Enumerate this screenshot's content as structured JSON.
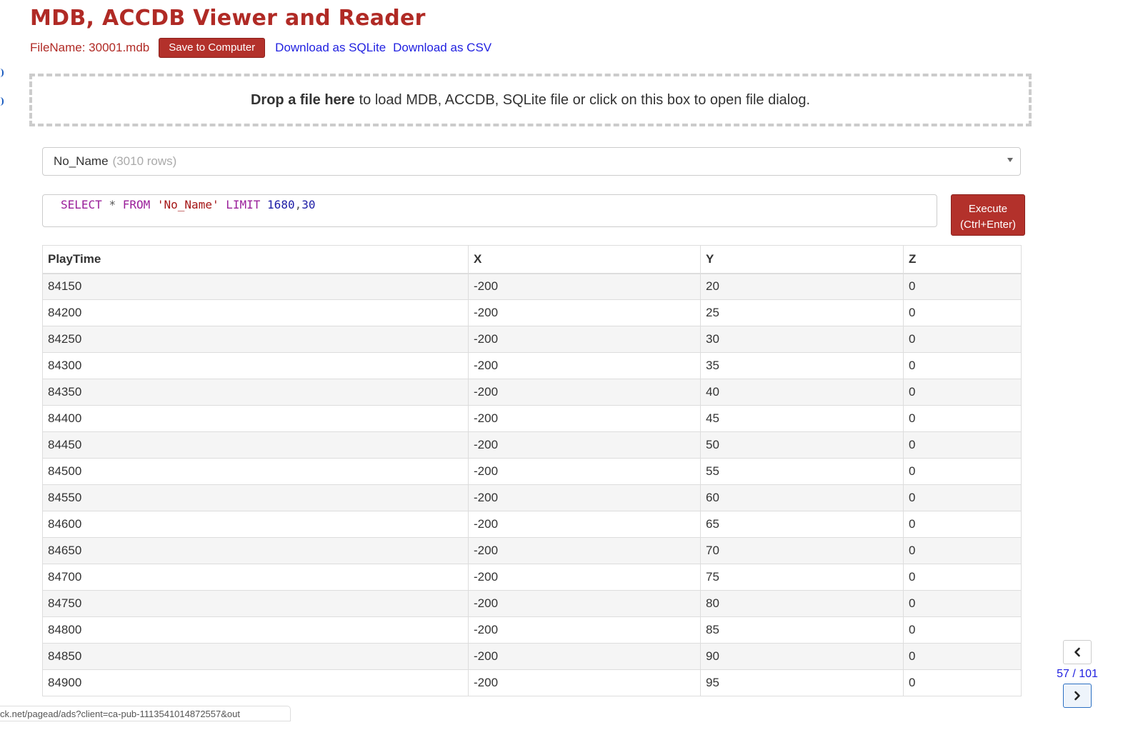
{
  "app": {
    "title": "MDB, ACCDB Viewer and Reader"
  },
  "file_bar": {
    "filename": "FileName: 30001.mdb",
    "save_label": "Save to Computer",
    "download_sqlite": "Download as SQLite",
    "download_csv": "Download as CSV"
  },
  "dropzone": {
    "bold_text": "Drop a file here",
    "rest_text": "to load MDB, ACCDB, SQLite file or click on this box to open file dialog."
  },
  "table_select": {
    "selected": "No_Name",
    "rows": "(3010 rows)"
  },
  "query": {
    "select_kw": "SELECT",
    "star": "*",
    "from_kw": "FROM",
    "table": "'No_Name'",
    "limit_kw": "LIMIT",
    "offset": "1680",
    "comma": ",",
    "count": "30"
  },
  "execute": {
    "line1": "Execute",
    "line2": "(Ctrl+Enter)"
  },
  "results": {
    "columns": [
      "PlayTime",
      "X",
      "Y",
      "Z"
    ],
    "rows": [
      [
        "84150",
        "-200",
        "20",
        "0"
      ],
      [
        "84200",
        "-200",
        "25",
        "0"
      ],
      [
        "84250",
        "-200",
        "30",
        "0"
      ],
      [
        "84300",
        "-200",
        "35",
        "0"
      ],
      [
        "84350",
        "-200",
        "40",
        "0"
      ],
      [
        "84400",
        "-200",
        "45",
        "0"
      ],
      [
        "84450",
        "-200",
        "50",
        "0"
      ],
      [
        "84500",
        "-200",
        "55",
        "0"
      ],
      [
        "84550",
        "-200",
        "60",
        "0"
      ],
      [
        "84600",
        "-200",
        "65",
        "0"
      ],
      [
        "84650",
        "-200",
        "70",
        "0"
      ],
      [
        "84700",
        "-200",
        "75",
        "0"
      ],
      [
        "84750",
        "-200",
        "80",
        "0"
      ],
      [
        "84800",
        "-200",
        "85",
        "0"
      ],
      [
        "84850",
        "-200",
        "90",
        "0"
      ],
      [
        "84900",
        "-200",
        "95",
        "0"
      ]
    ]
  },
  "pager": {
    "count": "57 / 101"
  },
  "status_bar": {
    "url": "ck.net/pagead/ads?client=ca-pub-1113541014872557&out"
  },
  "icons": {
    "prev": "chevron-left-icon",
    "next": "chevron-right-icon",
    "dropdown": "caret-down-icon"
  },
  "colors": {
    "accent": "#b3312b",
    "link": "#1f1fe0",
    "title": "#b02a25"
  }
}
